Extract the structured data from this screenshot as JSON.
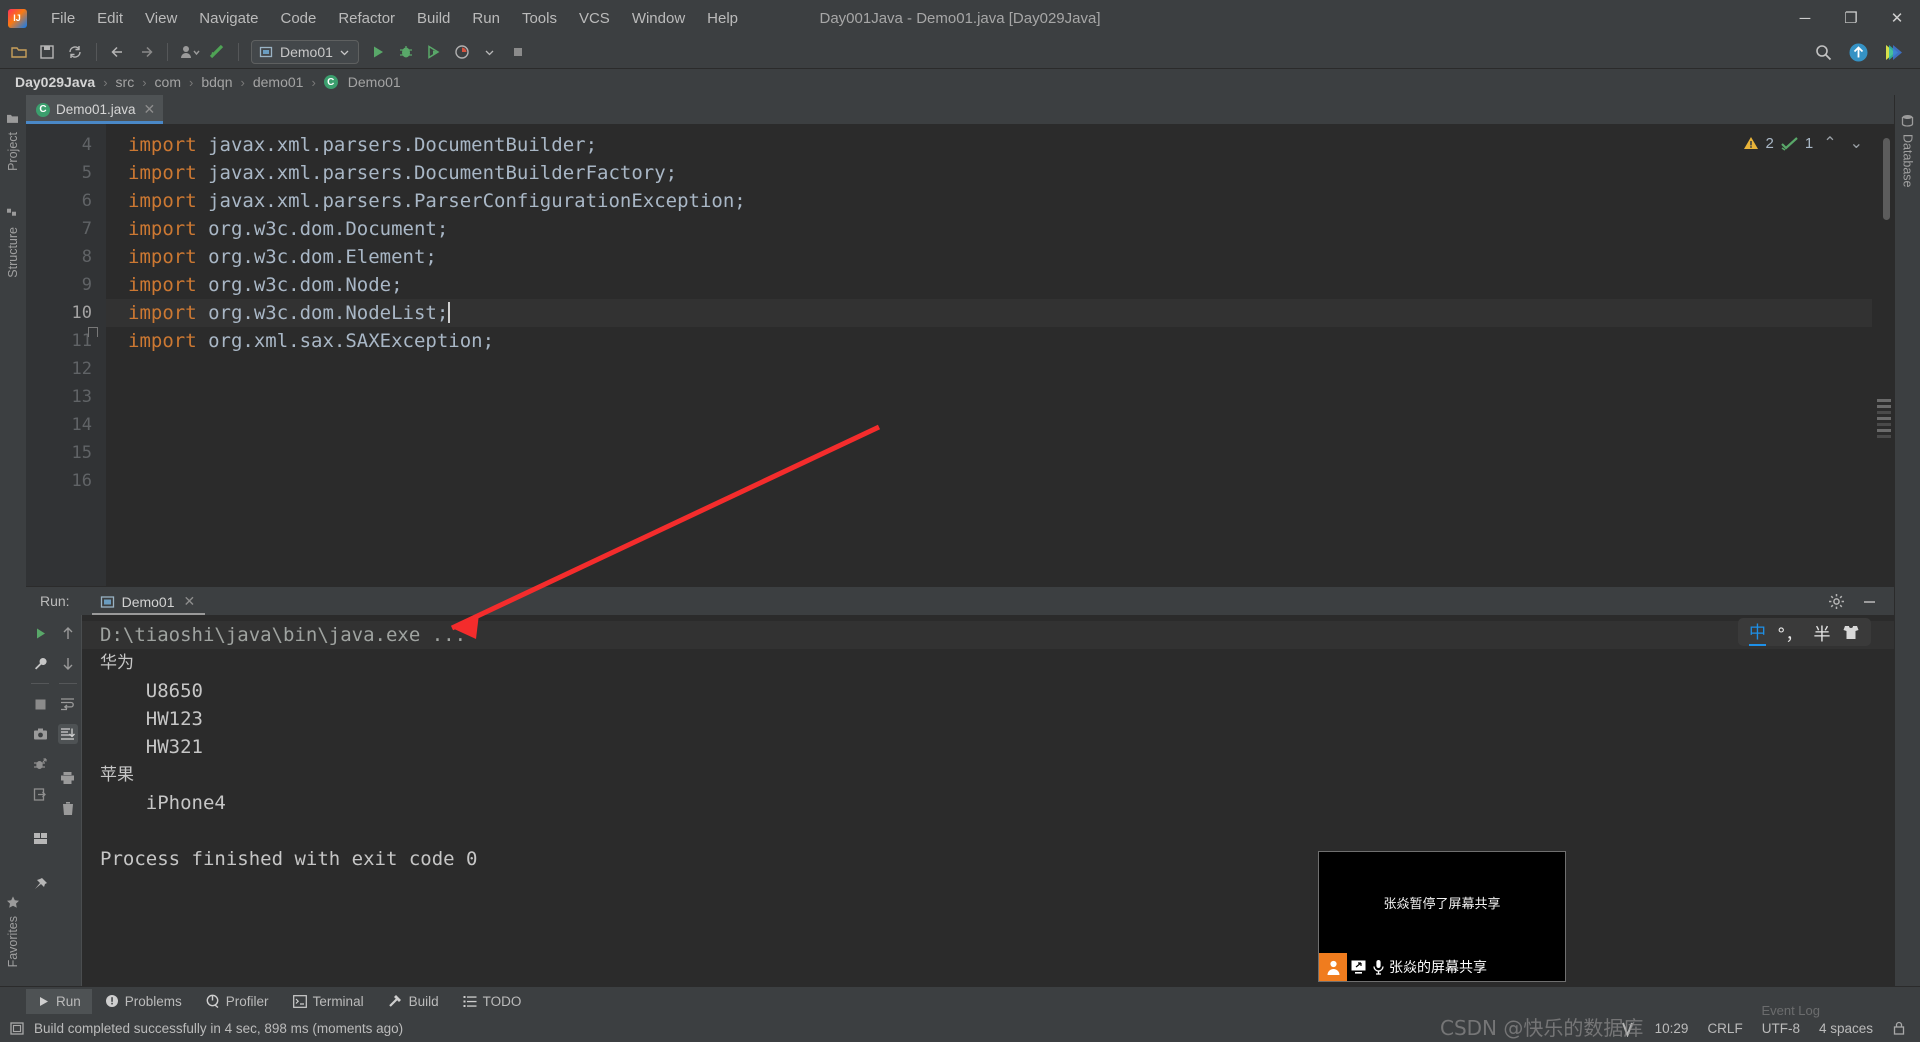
{
  "window": {
    "title": "Day001Java - Demo01.java [Day029Java]",
    "minimize": "─",
    "maximize": "❐",
    "close": "✕"
  },
  "menubar": {
    "items": [
      {
        "label": "File",
        "mnemonic": "F"
      },
      {
        "label": "Edit",
        "mnemonic": "E"
      },
      {
        "label": "View",
        "mnemonic": "V"
      },
      {
        "label": "Navigate",
        "mnemonic": "N"
      },
      {
        "label": "Code",
        "mnemonic": "C"
      },
      {
        "label": "Refactor",
        "mnemonic": "R"
      },
      {
        "label": "Build",
        "mnemonic": "B"
      },
      {
        "label": "Run",
        "mnemonic": "R"
      },
      {
        "label": "Tools",
        "mnemonic": "T"
      },
      {
        "label": "VCS",
        "mnemonic": "S"
      },
      {
        "label": "Window",
        "mnemonic": "W"
      },
      {
        "label": "Help",
        "mnemonic": "H"
      }
    ]
  },
  "toolbar": {
    "run_configuration": "Demo01",
    "icons": [
      "open-folder-icon",
      "save-all-icon",
      "sync-icon",
      "back-arrow-icon",
      "forward-arrow-icon",
      "update-project-icon",
      "commit-icon"
    ],
    "right_icons": [
      "search-everywhere-icon",
      "update-icon",
      "ide-feature-icon"
    ]
  },
  "breadcrumb": {
    "items": [
      "Day029Java",
      "src",
      "com",
      "bdqn",
      "demo01",
      "Demo01"
    ],
    "separator": "›"
  },
  "left_strip": {
    "top": [
      {
        "label": "Project",
        "icon": "project-folder-icon"
      },
      {
        "label": "Structure",
        "icon": "structure-icon"
      }
    ],
    "bottom": [
      {
        "label": "Favorites",
        "icon": "star-icon"
      }
    ]
  },
  "right_strip": {
    "items": [
      {
        "label": "Database",
        "icon": "database-icon"
      }
    ]
  },
  "editor": {
    "tab": {
      "filename": "Demo01.java",
      "icon": "java-class-icon",
      "close": "✕"
    },
    "first_line_number": 4,
    "lines": [
      {
        "num": 4,
        "keyword": "import",
        "rest": " javax.xml.parsers.DocumentBuilder;",
        "current": false,
        "fold": false
      },
      {
        "num": 5,
        "keyword": "import",
        "rest": " javax.xml.parsers.DocumentBuilderFactory;",
        "current": false,
        "fold": false
      },
      {
        "num": 6,
        "keyword": "import",
        "rest": " javax.xml.parsers.ParserConfigurationException;",
        "current": false,
        "fold": false
      },
      {
        "num": 7,
        "keyword": "import",
        "rest": " org.w3c.dom.Document;",
        "current": false,
        "fold": false
      },
      {
        "num": 8,
        "keyword": "import",
        "rest": " org.w3c.dom.Element;",
        "current": false,
        "fold": false
      },
      {
        "num": 9,
        "keyword": "import",
        "rest": " org.w3c.dom.Node;",
        "current": false,
        "fold": false
      },
      {
        "num": 10,
        "keyword": "import",
        "rest": " org.w3c.dom.NodeList;",
        "current": true,
        "fold": false
      },
      {
        "num": 11,
        "keyword": "import",
        "rest": " org.xml.sax.SAXException;",
        "current": false,
        "fold": true
      },
      {
        "num": 12,
        "keyword": "",
        "rest": "",
        "current": false,
        "fold": false
      },
      {
        "num": 13,
        "keyword": "",
        "rest": "",
        "current": false,
        "fold": false
      },
      {
        "num": 14,
        "keyword": "",
        "rest": "",
        "current": false,
        "fold": false
      },
      {
        "num": 15,
        "keyword": "",
        "rest": "",
        "current": false,
        "fold": false
      },
      {
        "num": 16,
        "keyword": "",
        "rest": "",
        "current": false,
        "fold": false
      }
    ],
    "inspection": {
      "warning_icon": "warning-triangle-icon",
      "warning_count": "2",
      "ok_icon": "inspection-check-icon",
      "ok_count": "1",
      "prev": "⌃",
      "next": "⌄"
    }
  },
  "run_window": {
    "label": "Run:",
    "tab": {
      "name": "Demo01",
      "icon": "run-config-icon",
      "close": "✕"
    },
    "header_icons": [
      "settings-gear-icon",
      "minimize-window-icon"
    ],
    "left_toolbar_a": [
      "rerun-play-icon",
      "edit-configuration-wrench-icon",
      "stop-square-icon",
      "camera-snapshot-icon",
      "thread-dump-icon",
      "export-icon",
      "layout-icon",
      "pin-icon"
    ],
    "left_toolbar_b": [
      "scroll-up-icon",
      "scroll-down-icon",
      "soft-wrap-icon",
      "scroll-to-end-icon",
      "print-icon",
      "trash-icon"
    ],
    "console": [
      {
        "text": "D:\\tiaoshi\\java\\bin\\java.exe ...",
        "type": "command"
      },
      {
        "text": "华为",
        "type": "cn"
      },
      {
        "text": "    U8650",
        "type": "out"
      },
      {
        "text": "    HW123",
        "type": "out"
      },
      {
        "text": "    HW321",
        "type": "out"
      },
      {
        "text": "苹果",
        "type": "cn"
      },
      {
        "text": "    iPhone4",
        "type": "out"
      },
      {
        "text": "",
        "type": "out"
      },
      {
        "text": "Process finished with exit code 0",
        "type": "out"
      }
    ]
  },
  "bottom_tabs": {
    "items": [
      {
        "label": "Run",
        "icon": "run-play-icon",
        "active": true
      },
      {
        "label": "Problems",
        "icon": "problems-icon",
        "active": false
      },
      {
        "label": "Profiler",
        "icon": "profiler-icon",
        "active": false
      },
      {
        "label": "Terminal",
        "icon": "terminal-icon",
        "active": false
      },
      {
        "label": "Build",
        "icon": "build-hammer-icon",
        "active": false
      },
      {
        "label": "TODO",
        "icon": "todo-list-icon",
        "active": false
      }
    ]
  },
  "status_bar": {
    "icon": "status-message-icon",
    "message": "Build completed successfully in 4 sec, 898 ms (moments ago)",
    "event_log": "Event Log",
    "right": {
      "vcs_icon": "vcs-branch-icon",
      "time": "10:29",
      "line_separator": "CRLF",
      "encoding": "UTF-8",
      "indent": "4 spaces",
      "lock_icon": "read-only-lock-icon"
    }
  },
  "ime_bar": {
    "mode": "中",
    "punctuation": "°，",
    "width_mode": "半",
    "skin_icon": "ime-skin-icon"
  },
  "screen_share": {
    "paused_message": "张焱暂停了屏幕共享",
    "bar_title": "张焱的屏幕共享",
    "avatar_icon": "person-avatar-icon",
    "screen_icon": "screen-share-icon",
    "mic_icon": "microphone-icon"
  },
  "watermark": {
    "text": "CSDN @快乐的数据库"
  },
  "colors": {
    "chrome": "#3c3f41",
    "editor_bg": "#2b2b2b",
    "keyword": "#cc7832",
    "identifier": "#a9b7c6",
    "accent": "#4a88c7",
    "warning": "#e8b339",
    "ok": "#59a869",
    "arrow": "#f42c2c",
    "share_accent": "#f07c1e"
  }
}
